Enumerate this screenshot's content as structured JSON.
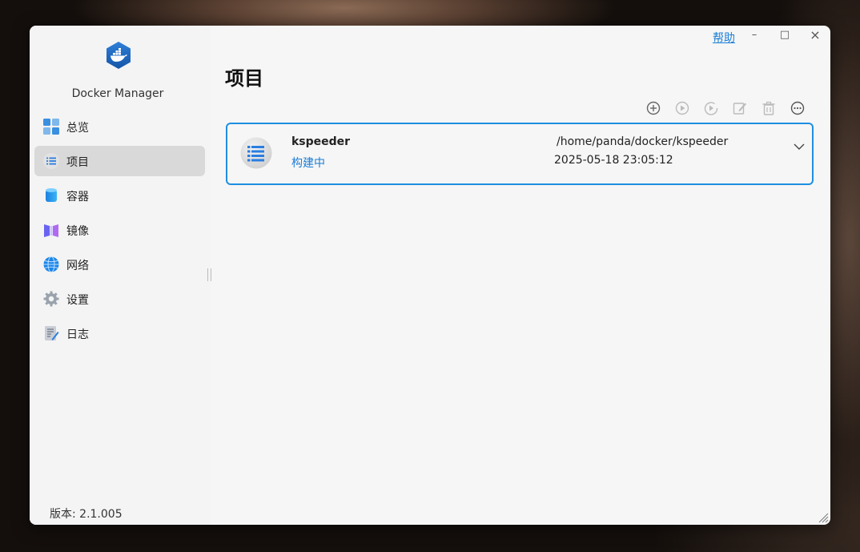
{
  "app": {
    "name": "Docker Manager",
    "version_text": "版本: 2.1.005"
  },
  "titlebar": {
    "help": "帮助",
    "minimize": "–",
    "maximize": "□",
    "close": "×"
  },
  "sidebar": {
    "items": [
      {
        "label": "总览",
        "icon": "overview-icon"
      },
      {
        "label": "项目",
        "icon": "project-list-icon",
        "active": true
      },
      {
        "label": "容器",
        "icon": "container-icon"
      },
      {
        "label": "镜像",
        "icon": "image-icon"
      },
      {
        "label": "网络",
        "icon": "network-globe-icon"
      },
      {
        "label": "设置",
        "icon": "gear-icon"
      },
      {
        "label": "日志",
        "icon": "log-icon"
      }
    ]
  },
  "main": {
    "title": "项目",
    "toolbar": [
      "add-icon",
      "start-icon",
      "restart-icon",
      "edit-icon",
      "delete-icon",
      "more-icon"
    ],
    "projects": [
      {
        "name": "kspeeder",
        "status": "构建中",
        "path": "/home/panda/docker/kspeeder",
        "time": "2025-05-18 23:05:12"
      }
    ]
  },
  "colors": {
    "accent": "#1a7ed6",
    "card_border": "#1f8fe0",
    "active_nav": "#d9d9d9"
  }
}
